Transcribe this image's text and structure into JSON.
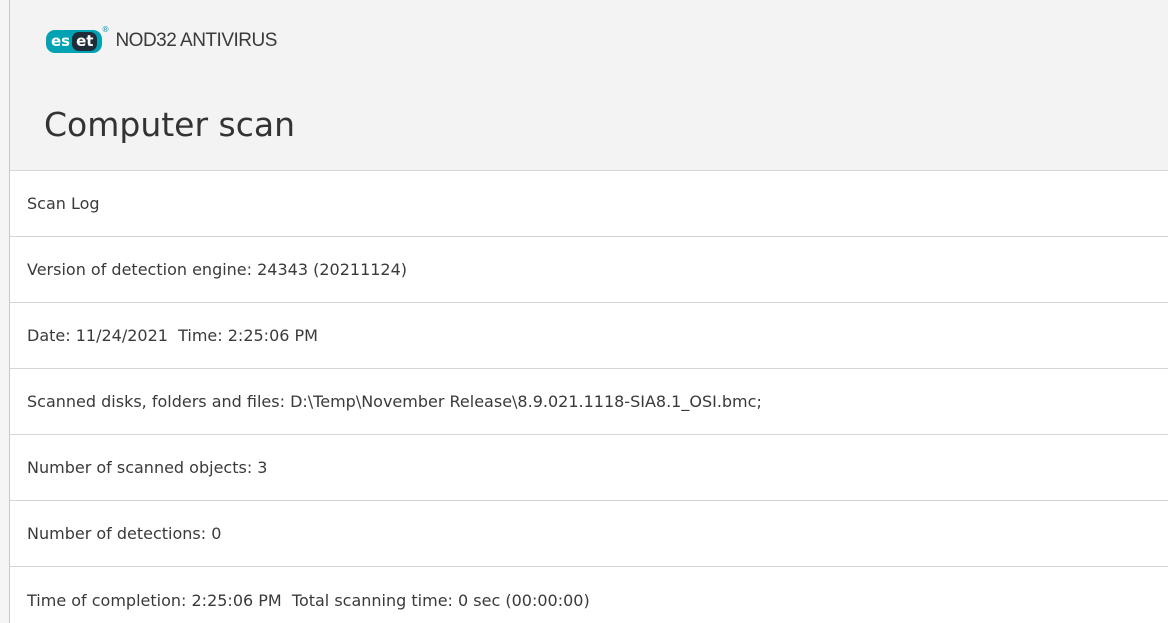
{
  "app": {
    "logo_text": "eset",
    "product_name": "NOD32 ANTIVIRUS",
    "brand_color": "#00a2b4"
  },
  "page": {
    "title": "Computer scan"
  },
  "log": {
    "lines": [
      "Scan Log",
      "Version of detection engine: 24343 (20211124)",
      "Date: 11/24/2021  Time: 2:25:06 PM",
      "Scanned disks, folders and files: D:\\Temp\\November Release\\8.9.021.1118-SIA8.1_OSI.bmc;",
      "Number of scanned objects: 3",
      "Number of detections: 0",
      "Time of completion: 2:25:06 PM  Total scanning time: 0 sec (00:00:00)"
    ]
  }
}
